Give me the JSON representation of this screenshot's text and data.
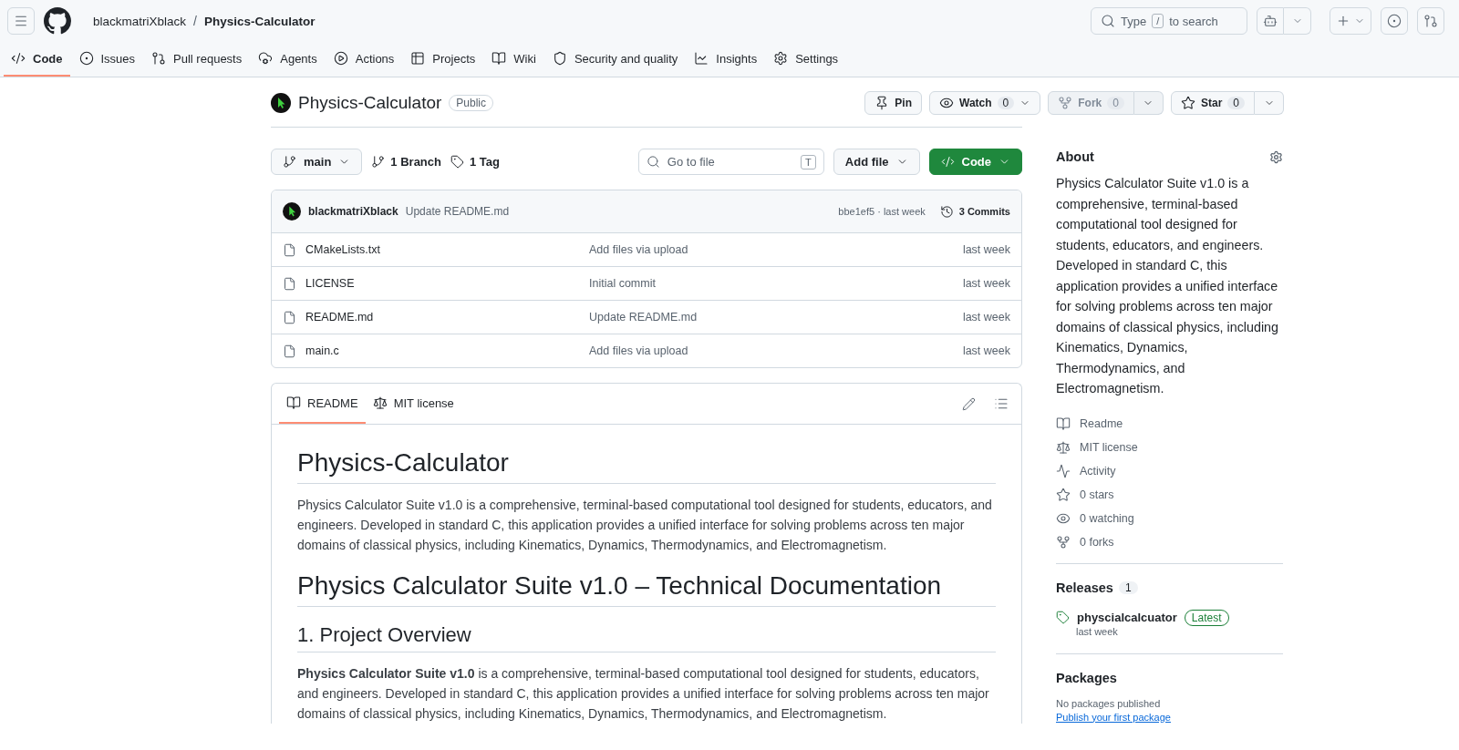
{
  "header": {
    "owner": "blackmatriXblack",
    "separator": "/",
    "repo": "Physics-Calculator",
    "search": {
      "before": "Type",
      "key": "/",
      "after": "to search"
    }
  },
  "nav": [
    {
      "label": "Code",
      "selected": true
    },
    {
      "label": "Issues",
      "selected": false
    },
    {
      "label": "Pull requests",
      "selected": false
    },
    {
      "label": "Agents",
      "selected": false
    },
    {
      "label": "Actions",
      "selected": false
    },
    {
      "label": "Projects",
      "selected": false
    },
    {
      "label": "Wiki",
      "selected": false
    },
    {
      "label": "Security and quality",
      "selected": false
    },
    {
      "label": "Insights",
      "selected": false
    },
    {
      "label": "Settings",
      "selected": false
    }
  ],
  "repo": {
    "name": "Physics-Calculator",
    "visibility": "Public",
    "actions": [
      {
        "kind": "pin",
        "label": "Pin",
        "disabled": false
      },
      {
        "kind": "watch",
        "label": "Watch",
        "count": "0",
        "disabled": false
      },
      {
        "kind": "fork",
        "label": "Fork",
        "count": "0",
        "disabled": true
      },
      {
        "kind": "star",
        "label": "Star",
        "count": "0",
        "disabled": false
      }
    ]
  },
  "toolbar": {
    "branch": "main",
    "branches": "1 Branch",
    "tags": "1 Tag",
    "go_to_file": {
      "placeholder": "Go to file",
      "key": "T"
    },
    "add_file": "Add file",
    "code": "Code"
  },
  "latest_commit": {
    "author": "blackmatriXblack",
    "message": "Update README.md",
    "hash_time": "bbe1ef5 · last week",
    "commits": "3 Commits"
  },
  "files": [
    {
      "name": "CMakeLists.txt",
      "message": "Add files via upload",
      "time": "last week"
    },
    {
      "name": "LICENSE",
      "message": "Initial commit",
      "time": "last week"
    },
    {
      "name": "README.md",
      "message": "Update README.md",
      "time": "last week"
    },
    {
      "name": "main.c",
      "message": "Add files via upload",
      "time": "last week"
    }
  ],
  "readme": {
    "tabs": [
      {
        "label": "README",
        "selected": true
      },
      {
        "label": "MIT license",
        "selected": false
      }
    ],
    "blocks": [
      {
        "kind": "h1",
        "text": "Physics-Calculator"
      },
      {
        "kind": "p",
        "text": "Physics Calculator Suite v1.0 is a comprehensive, terminal-based computational tool designed for students, educators, and engineers. Developed in standard C, this application provides a unified interface for solving problems across ten major domains of classical physics, including Kinematics, Dynamics, Thermodynamics, and Electromagnetism."
      },
      {
        "kind": "h1",
        "text": "Physics Calculator Suite v1.0 – Technical Documentation"
      },
      {
        "kind": "h2",
        "text": "1. Project Overview"
      },
      {
        "kind": "p",
        "text": "**Physics Calculator Suite v1.0** is a comprehensive, terminal-based computational tool designed for students, educators, and engineers. Developed in standard C, this application provides a unified interface for solving problems across ten major domains of classical physics, including Kinematics, Dynamics, Thermodynamics, and Electromagnetism."
      }
    ]
  },
  "about": {
    "title": "About",
    "description": "Physics Calculator Suite v1.0 is a comprehensive, terminal-based computational tool designed for students, educators, and engineers. Developed in standard C, this application provides a unified interface for solving problems across ten major domains of classical physics, including Kinematics, Dynamics, Thermodynamics, and Electromagnetism.",
    "links": [
      {
        "label": "Readme"
      },
      {
        "label": "MIT license"
      },
      {
        "label": "Activity"
      },
      {
        "label": "0 stars"
      },
      {
        "label": "0 watching"
      },
      {
        "label": "0 forks"
      }
    ]
  },
  "releases": {
    "title": "Releases",
    "count": "1",
    "name": "physcialcalcuator",
    "badge": "Latest",
    "time": "last week"
  },
  "packages": {
    "title": "Packages",
    "empty": "No packages published",
    "link": "Publish your first package"
  }
}
